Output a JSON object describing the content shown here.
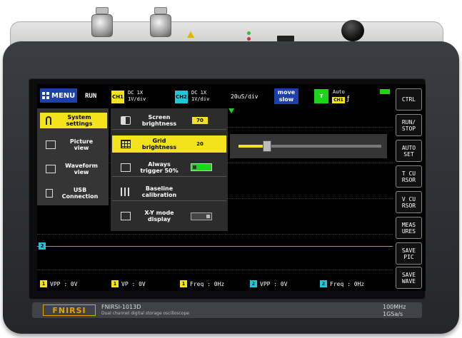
{
  "device": {
    "brand": "FNIRSI",
    "model": "FNIRSI-1013D",
    "subtitle": "Dual channel digital storage oscilloscope",
    "bandwidth": "100MHz",
    "sample_rate": "1GSa/s"
  },
  "topbar": {
    "menu_label": "MENU",
    "run_status": "RUN",
    "ch1": {
      "badge": "CH1",
      "coupling": "DC",
      "probe": "1X",
      "scale": "1V/div"
    },
    "ch2": {
      "badge": "CH2",
      "coupling": "DC",
      "probe": "1X",
      "scale": "1V/div"
    },
    "timebase": "20uS/div",
    "move_mode": [
      "move",
      "slow"
    ],
    "trigger": {
      "badge": "T",
      "mode": "Auto",
      "source": "CH1",
      "edge": "ƒ"
    }
  },
  "main_menu": [
    {
      "label": [
        "System",
        "settings"
      ],
      "icon": "wrench-icon",
      "selected": true
    },
    {
      "label": [
        "Picture",
        "view"
      ],
      "icon": "picture-icon",
      "selected": false
    },
    {
      "label": [
        "Waveform",
        "view"
      ],
      "icon": "waveform-icon",
      "selected": false
    },
    {
      "label": [
        "USB",
        "Connection"
      ],
      "icon": "usb-icon",
      "selected": false
    }
  ],
  "settings_menu": [
    {
      "label": [
        "Screen",
        "brightness"
      ],
      "icon": "brightness-icon",
      "value": "70",
      "selected": false
    },
    {
      "label": [
        "Grid",
        "brightness"
      ],
      "icon": "grid-icon",
      "value": "20",
      "selected": true
    },
    {
      "label": [
        "Always",
        "trigger 50%"
      ],
      "icon": "trigger-icon",
      "toggle": true,
      "selected": false
    },
    {
      "label": [
        "Baseline",
        "calibration"
      ],
      "icon": "sliders-icon",
      "selected": false
    },
    {
      "label": [
        "X-Y mode",
        "display"
      ],
      "icon": "xy-icon",
      "toggle": false,
      "selected": false
    }
  ],
  "slider": {
    "value_fraction": 0.2
  },
  "trace": {
    "marker": "2",
    "color": "#1fc8d8"
  },
  "measurements": [
    {
      "channel": "1",
      "text": "VPP : 0V",
      "color": "#f4e21c"
    },
    {
      "channel": "1",
      "text": "VP : 0V",
      "color": "#f4e21c"
    },
    {
      "channel": "1",
      "text": "Freq : 0Hz",
      "color": "#f4e21c"
    },
    {
      "channel": "2",
      "text": "VPP : 0V",
      "color": "#1fc8d8"
    },
    {
      "channel": "2",
      "text": "Freq : 0Hz",
      "color": "#1fc8d8"
    }
  ],
  "sidebar_buttons": [
    [
      "CTRL"
    ],
    [
      "RUN/",
      "STOP"
    ],
    [
      "AUTO",
      "SET"
    ],
    [
      "T CU",
      "RSOR"
    ],
    [
      "V CU",
      "RSOR"
    ],
    [
      "MEAS",
      "URES"
    ],
    [
      "SAVE",
      "PIC"
    ],
    [
      "SAVE",
      "WAVE"
    ]
  ],
  "colors": {
    "ch1": "#f4e21c",
    "ch2": "#1fc8d8",
    "trigger": "#19d619",
    "menu": "#1c3fa8",
    "toggle_on": "#19d619"
  }
}
